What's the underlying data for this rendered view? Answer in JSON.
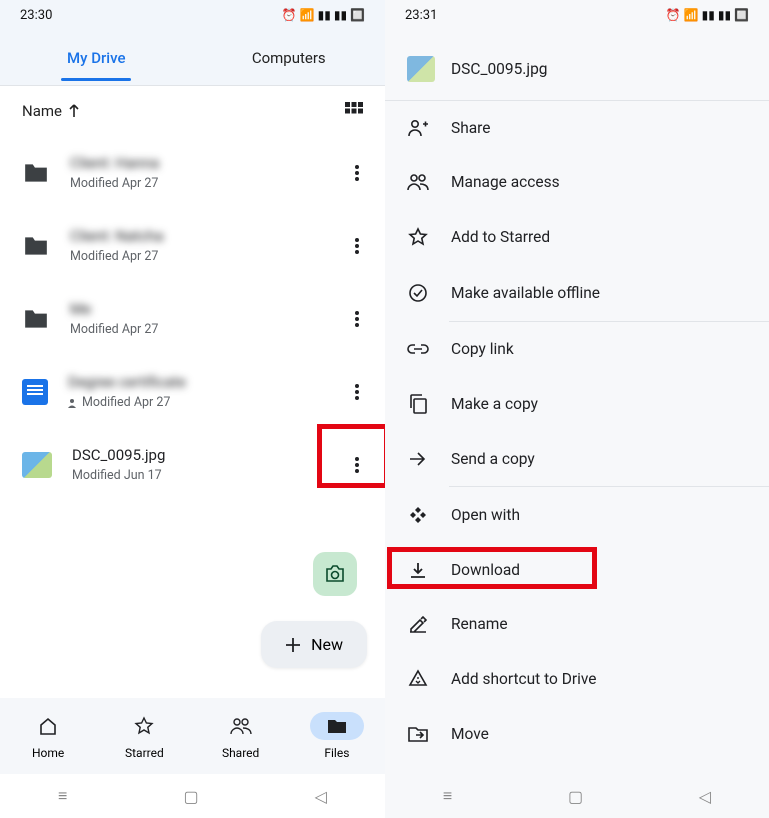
{
  "left": {
    "status_time": "23:30",
    "tabs": {
      "my_drive": "My Drive",
      "computers": "Computers"
    },
    "sort": {
      "label": "Name",
      "view_icon": "grid-view-icon"
    },
    "files": [
      {
        "name": "Client: Hanna",
        "meta": "Modified Apr 27",
        "type": "folder",
        "blurred": true
      },
      {
        "name": "Client: Natcha",
        "meta": "Modified Apr 27",
        "type": "folder",
        "blurred": true
      },
      {
        "name": "Me",
        "meta": "Modified Apr 27",
        "type": "folder",
        "blurred": true
      },
      {
        "name": "Degree certificate",
        "meta": "Modified Apr 27",
        "type": "doc",
        "blurred": true,
        "shared": true
      },
      {
        "name": "DSC_0095.jpg",
        "meta": "Modified Jun 17",
        "type": "img",
        "blurred": false
      }
    ],
    "new_button": "New",
    "nav": {
      "home": "Home",
      "starred": "Starred",
      "shared": "Shared",
      "files": "Files"
    }
  },
  "right": {
    "status_time": "23:31",
    "file_title": "DSC_0095.jpg",
    "items": [
      {
        "icon": "person-add-icon",
        "label": "Share"
      },
      {
        "icon": "people-icon",
        "label": "Manage access"
      },
      {
        "icon": "star-icon",
        "label": "Add to Starred"
      },
      {
        "icon": "offline-icon",
        "label": "Make available offline"
      },
      {
        "sep": true
      },
      {
        "icon": "link-icon",
        "label": "Copy link"
      },
      {
        "icon": "copy-icon",
        "label": "Make a copy"
      },
      {
        "icon": "send-icon",
        "label": "Send a copy"
      },
      {
        "sep": true
      },
      {
        "icon": "open-with-icon",
        "label": "Open with"
      },
      {
        "icon": "download-icon",
        "label": "Download",
        "highlight": true
      },
      {
        "icon": "rename-icon",
        "label": "Rename"
      },
      {
        "icon": "shortcut-icon",
        "label": "Add shortcut to Drive"
      },
      {
        "icon": "move-icon",
        "label": "Move"
      }
    ]
  }
}
